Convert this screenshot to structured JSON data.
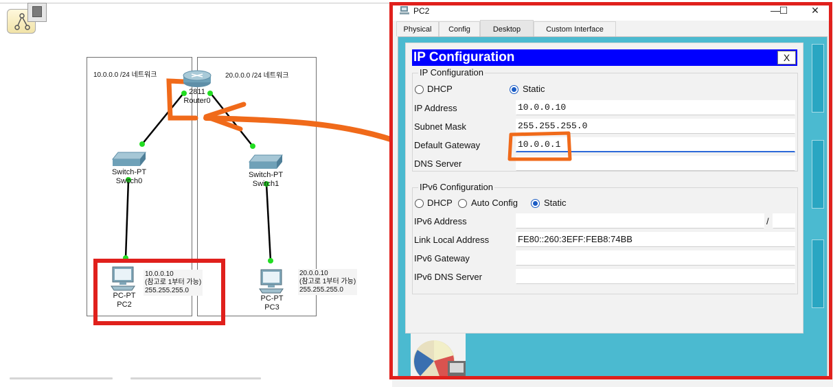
{
  "workspace": {
    "zone_left_label": "10.0.0.0 /24 네트워크",
    "zone_right_label": "20.0.0.0 /24 네트워크",
    "router": {
      "model": "2811",
      "name": "Router0"
    },
    "switch0": {
      "model": "Switch-PT",
      "name": "Switch0"
    },
    "switch1": {
      "model": "Switch-PT",
      "name": "Switch1"
    },
    "pc2": {
      "model": "PC-PT",
      "name": "PC2",
      "note_ip": "10.0.0.10",
      "note_hint": "(참고로 1부터 가능)",
      "note_mask": "255.255.255.0"
    },
    "pc3": {
      "model": "PC-PT",
      "name": "PC3",
      "note_ip": "20.0.0.10",
      "note_hint": "(참고로 1부터 가능)",
      "note_mask": "255.255.255.0"
    }
  },
  "window": {
    "title": "PC2",
    "controls": {
      "minimize": "—",
      "maximize": "☐",
      "close": "✕"
    },
    "tabs": [
      "Physical",
      "Config",
      "Desktop",
      "Custom Interface"
    ],
    "active_tab": "Desktop"
  },
  "ipconfig": {
    "header": "IP Configuration",
    "close_label": "X",
    "ipv4_group": "IP Configuration",
    "dhcp_label": "DHCP",
    "static_label": "Static",
    "mode": "Static",
    "fields": {
      "ip_address_label": "IP Address",
      "ip_address": "10.0.0.10",
      "subnet_mask_label": "Subnet Mask",
      "subnet_mask": "255.255.255.0",
      "gateway_label": "Default Gateway",
      "gateway": "10.0.0.1",
      "dns_label": "DNS Server",
      "dns": ""
    },
    "ipv6_group": "IPv6 Configuration",
    "ipv6_dhcp_label": "DHCP",
    "ipv6_auto_label": "Auto Config",
    "ipv6_static_label": "Static",
    "ipv6_mode": "Static",
    "ipv6_fields": {
      "address_label": "IPv6 Address",
      "address": "",
      "prefix_sep": "/",
      "prefix": "",
      "link_local_label": "Link Local Address",
      "link_local": "FE80::260:3EFF:FEB8:74BB",
      "gateway_label": "IPv6 Gateway",
      "gateway": "",
      "dns_label": "IPv6 DNS Server",
      "dns": ""
    }
  },
  "colors": {
    "annotation_red": "#e0201c",
    "annotation_orange": "#f06a1a",
    "header_blue": "#0000ff",
    "desktop_teal": "#4bbad0",
    "link_green": "#22dd22"
  },
  "icons": [
    "topology-tool-icon",
    "router-icon",
    "switch-icon",
    "pc-icon",
    "pc2-window-icon",
    "desktop-app-icon"
  ]
}
